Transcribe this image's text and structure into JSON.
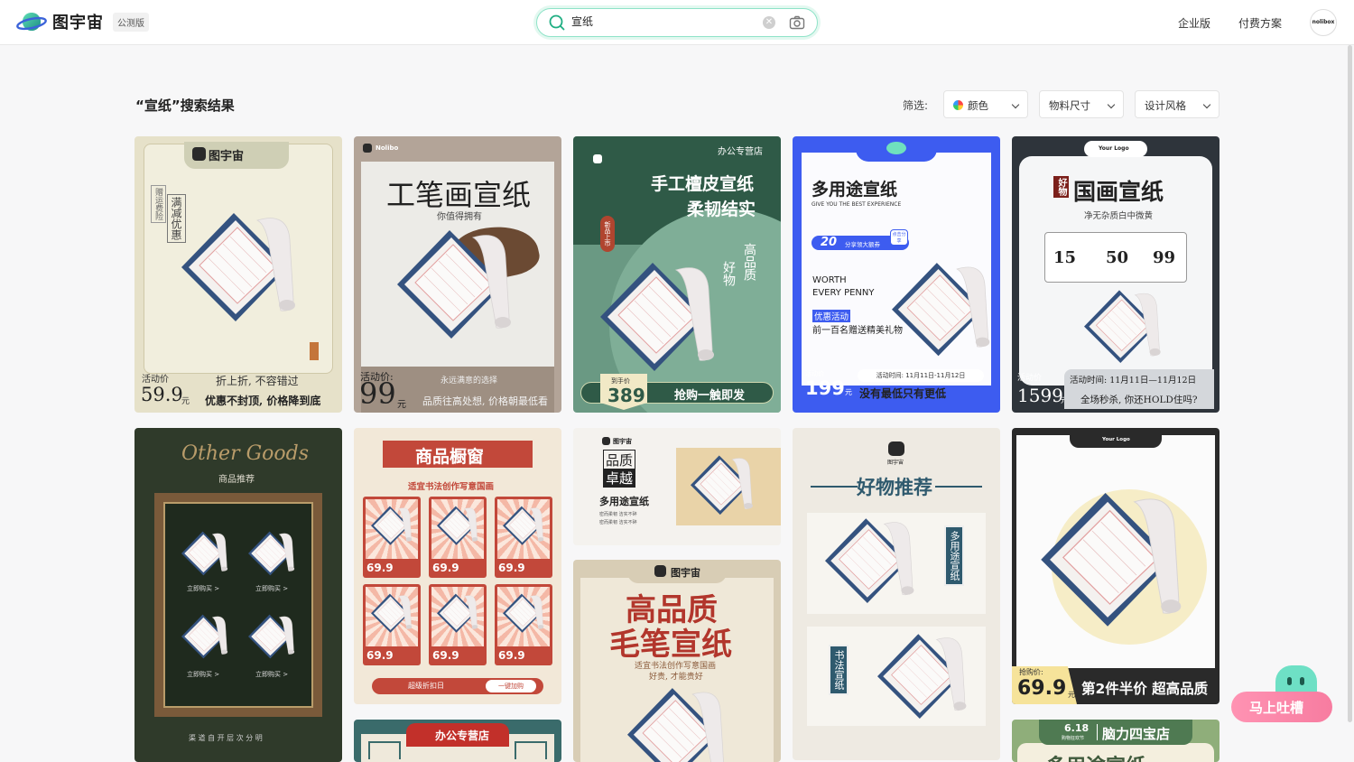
{
  "header": {
    "brand": "图宇宙",
    "beta": "公测版",
    "search_value": "宣纸",
    "enterprise": "企业版",
    "pricing": "付费方案",
    "avatar_text": "nolibox"
  },
  "results": {
    "title": "“宣纸”搜索结果",
    "filter_label": "筛选:",
    "filters": [
      "颜色",
      "物料尺寸",
      "设计风格"
    ]
  },
  "cards": {
    "c1": {
      "brand": "图宇宙",
      "tag1": "满减优惠",
      "tag2": "赠运费险",
      "label": "活动价",
      "price": "59.9",
      "unit": "元",
      "line1": "折上折, 不容错过",
      "line2": "优惠不封顶, 价格降到底"
    },
    "c2": {
      "brand": "Nolibo",
      "title": "工笔画宣纸",
      "sub": "你值得拥有",
      "label": "活动价:",
      "price": "99",
      "unit": "元",
      "line1": "永远满意的选择",
      "line2": "品质往高处想, 价格朝最低看"
    },
    "c3": {
      "shop": "办公专营店",
      "title1": "手工檀皮宣纸",
      "title2": "柔韧结实",
      "badge": "新品上市",
      "q1": "好物",
      "q2": "高品质",
      "label": "到手价",
      "price": "389",
      "cta": "抢购一触即发"
    },
    "c4": {
      "title": "多用途宣纸",
      "sub": "GIVE YOU THE BEST EXPERIENCE",
      "coupon": "20",
      "coupon_text": "分享领大额券",
      "coupon_tip": "点击分享",
      "w1": "WORTH",
      "w2": "EVERY PENNY",
      "tag": "优惠活动",
      "gift": "前一百名赠送精美礼物",
      "label": "活动价",
      "time": "活动时间: 11月11日-11月12日",
      "price": "199",
      "unit": "元",
      "slogan": "没有最低只有更低"
    },
    "c5": {
      "logo": "Your Logo",
      "tag": "好物",
      "title": "国画宣纸",
      "sub": "净无杂质白中微黄",
      "v1": "15",
      "v2": "50",
      "v3": "99",
      "label": "活动价",
      "price": "1599",
      "unit": "元",
      "time": "活动时间: 11月11日—11月12日",
      "slogan": "全场秒杀, 你还HOLD住吗?"
    },
    "c6": {
      "title": "Other Goods",
      "sub": "商品推荐",
      "buy": "立即购买 >",
      "footer": "渠 道 自 开 层 次 分 明"
    },
    "c7": {
      "title": "商品橱窗",
      "sub": "适宜书法创作写意国画",
      "price": "69.9",
      "discount": "超级折扣日",
      "cart": "一键加购"
    },
    "c8": {
      "brand": "图宇宙",
      "t1": "品质",
      "t2": "卓越",
      "name": "多用途宣纸",
      "d1": "密而柔韧 洁实不碎",
      "d2": "密而柔韧 洁实不碎"
    },
    "c9": {
      "brand": "图宇宙",
      "title": "好物推荐",
      "v1": "多用途宣纸",
      "v2": "书法宣纸"
    },
    "c10": {
      "logo": "Your Logo",
      "label": "抢购价:",
      "price": "69.9",
      "unit": "元",
      "slogan": "第2件半价 超高品质"
    },
    "c11": {
      "shop": "办公专营店"
    },
    "c12": {
      "brand": "图宇宙",
      "title1": "高品质",
      "title2": "毛笔宣纸",
      "sub1": "适宜书法创作写意国画",
      "sub2": "好贵, 才能贵好"
    },
    "c13": {
      "date": "6.18",
      "date_sub": "购物狂欢节",
      "shop": "脑力四宝店",
      "title": "多用途宣纸"
    }
  },
  "feedback": {
    "label": "马上吐槽"
  }
}
